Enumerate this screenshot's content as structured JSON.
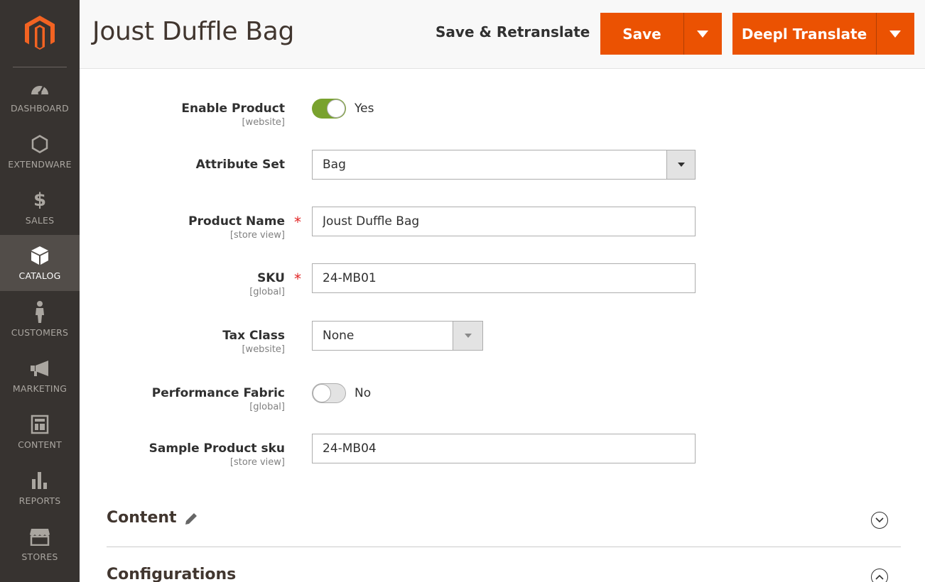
{
  "sidebar": {
    "logo": "magento-logo",
    "items": [
      {
        "label": "DASHBOARD",
        "icon": "dashboard-gauge-icon"
      },
      {
        "label": "EXTENDWARE",
        "icon": "hexagon-icon"
      },
      {
        "label": "SALES",
        "icon": "dollar-icon"
      },
      {
        "label": "CATALOG",
        "icon": "box-icon",
        "active": true
      },
      {
        "label": "CUSTOMERS",
        "icon": "person-icon"
      },
      {
        "label": "MARKETING",
        "icon": "megaphone-icon"
      },
      {
        "label": "CONTENT",
        "icon": "layout-icon"
      },
      {
        "label": "REPORTS",
        "icon": "bar-chart-icon"
      },
      {
        "label": "STORES",
        "icon": "storefront-icon"
      }
    ]
  },
  "header": {
    "title": "Joust Duffle Bag",
    "save_retranslate": "Save & Retranslate",
    "save": "Save",
    "deepl": "Deepl Translate"
  },
  "form": {
    "enable_product": {
      "label": "Enable Product",
      "scope": "[website]",
      "value": "Yes",
      "on": true
    },
    "attribute_set": {
      "label": "Attribute Set",
      "value": "Bag"
    },
    "product_name": {
      "label": "Product Name",
      "scope": "[store view]",
      "value": "Joust Duffle Bag",
      "required": "*"
    },
    "sku": {
      "label": "SKU",
      "scope": "[global]",
      "value": "24-MB01",
      "required": "*"
    },
    "tax_class": {
      "label": "Tax Class",
      "scope": "[website]",
      "value": "None"
    },
    "performance_fabric": {
      "label": "Performance Fabric",
      "scope": "[global]",
      "value": "No",
      "on": false
    },
    "sample_sku": {
      "label": "Sample Product sku",
      "scope": "[store view]",
      "value": "24-MB04"
    }
  },
  "sections": {
    "content": "Content",
    "configurations": "Configurations"
  },
  "colors": {
    "accent": "#eb5202",
    "sidebar": "#373330",
    "toggle_on": "#79a22e"
  }
}
